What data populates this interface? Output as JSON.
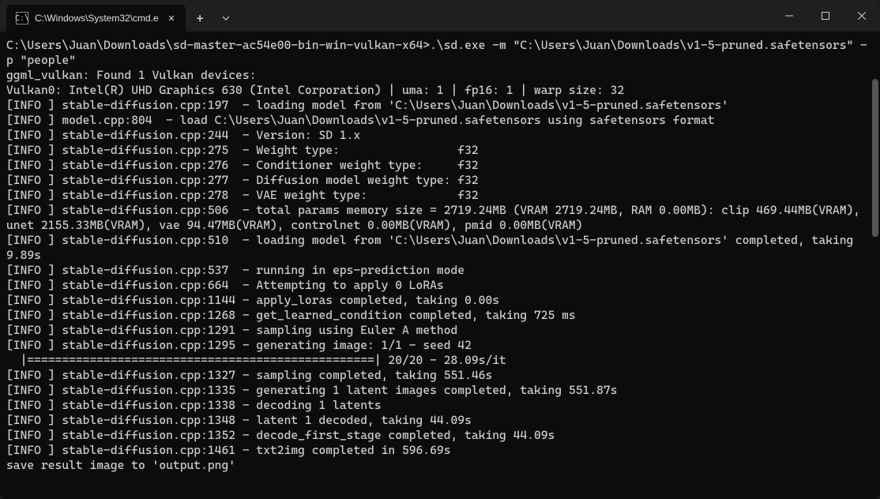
{
  "titlebar": {
    "tab_title": "C:\\Windows\\System32\\cmd.e",
    "tab_icon_text": "C:\\"
  },
  "terminal": {
    "prompt_line": "C:\\Users\\Juan\\Downloads\\sd-master-ac54e00-bin-win-vulkan-x64>.\\sd.exe -m \"C:\\Users\\Juan\\Downloads\\v1-5-pruned.safetensors\" -p \"people\"",
    "lines": [
      "ggml_vulkan: Found 1 Vulkan devices:",
      "Vulkan0: Intel(R) UHD Graphics 630 (Intel Corporation) | uma: 1 | fp16: 1 | warp size: 32",
      "[INFO ] stable-diffusion.cpp:197  - loading model from 'C:\\Users\\Juan\\Downloads\\v1-5-pruned.safetensors'",
      "[INFO ] model.cpp:804  - load C:\\Users\\Juan\\Downloads\\v1-5-pruned.safetensors using safetensors format",
      "[INFO ] stable-diffusion.cpp:244  - Version: SD 1.x",
      "[INFO ] stable-diffusion.cpp:275  - Weight type:                 f32",
      "[INFO ] stable-diffusion.cpp:276  - Conditioner weight type:     f32",
      "[INFO ] stable-diffusion.cpp:277  - Diffusion model weight type: f32",
      "[INFO ] stable-diffusion.cpp:278  - VAE weight type:             f32",
      "[INFO ] stable-diffusion.cpp:506  - total params memory size = 2719.24MB (VRAM 2719.24MB, RAM 0.00MB): clip 469.44MB(VRAM), unet 2155.33MB(VRAM), vae 94.47MB(VRAM), controlnet 0.00MB(VRAM), pmid 0.00MB(VRAM)",
      "[INFO ] stable-diffusion.cpp:510  - loading model from 'C:\\Users\\Juan\\Downloads\\v1-5-pruned.safetensors' completed, taking 9.89s",
      "[INFO ] stable-diffusion.cpp:537  - running in eps-prediction mode",
      "[INFO ] stable-diffusion.cpp:664  - Attempting to apply 0 LoRAs",
      "[INFO ] stable-diffusion.cpp:1144 - apply_loras completed, taking 0.00s",
      "[INFO ] stable-diffusion.cpp:1268 - get_learned_condition completed, taking 725 ms",
      "[INFO ] stable-diffusion.cpp:1291 - sampling using Euler A method",
      "[INFO ] stable-diffusion.cpp:1295 - generating image: 1/1 - seed 42",
      "  |==================================================| 20/20 - 28.09s/it",
      "[INFO ] stable-diffusion.cpp:1327 - sampling completed, taking 551.46s",
      "[INFO ] stable-diffusion.cpp:1335 - generating 1 latent images completed, taking 551.87s",
      "[INFO ] stable-diffusion.cpp:1338 - decoding 1 latents",
      "[INFO ] stable-diffusion.cpp:1348 - latent 1 decoded, taking 44.09s",
      "[INFO ] stable-diffusion.cpp:1352 - decode_first_stage completed, taking 44.09s",
      "[INFO ] stable-diffusion.cpp:1461 - txt2img completed in 596.69s",
      "save result image to 'output.png'"
    ]
  }
}
